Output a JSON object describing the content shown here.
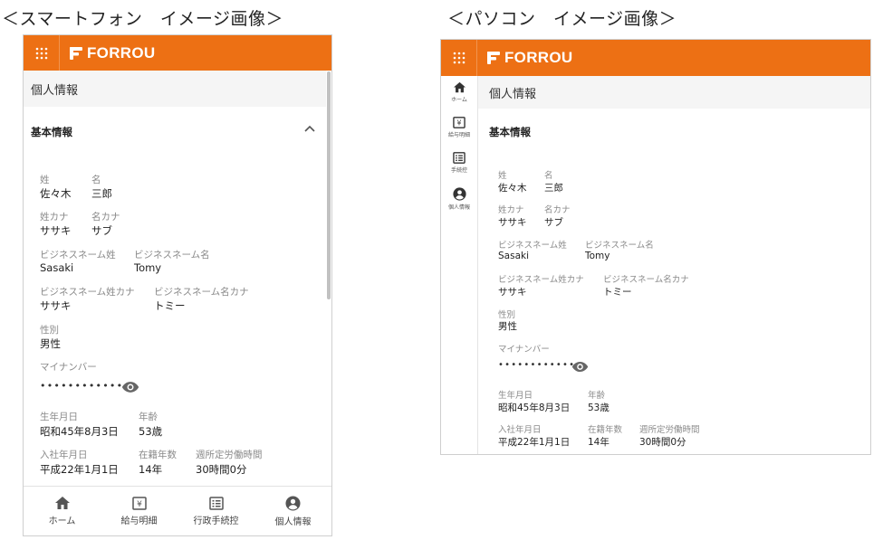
{
  "captions": {
    "smartphone": "＜スマートフォン　イメージ画像＞",
    "pc": "＜パソコン　イメージ画像＞"
  },
  "app": {
    "logo_text": "FORROU",
    "accent_color": "#ed7014",
    "page_title": "個人情報",
    "section_title": "基本情報"
  },
  "icons": {
    "grid": "grid-icon",
    "chevron": "chevron-up-icon",
    "eye": "eye-icon",
    "home": "home-icon",
    "salary": "yen-slip-icon",
    "procedure": "form-icon",
    "profile": "account-circle-icon"
  },
  "fields": {
    "last_name": {
      "label": "姓",
      "value": "佐々木"
    },
    "first_name": {
      "label": "名",
      "value": "三郎"
    },
    "last_name_kana": {
      "label": "姓カナ",
      "value": "ササキ"
    },
    "first_name_kana": {
      "label": "名カナ",
      "value": "サブ"
    },
    "business_last": {
      "label": "ビジネスネーム姓",
      "value": "Sasaki"
    },
    "business_first": {
      "label": "ビジネスネーム名",
      "value": "Tomy"
    },
    "business_last_kana": {
      "label": "ビジネスネーム姓カナ",
      "value": "ササキ"
    },
    "business_first_kana": {
      "label": "ビジネスネーム名カナ",
      "value": "トミー"
    },
    "gender": {
      "label": "性別",
      "value": "男性"
    },
    "my_number": {
      "label": "マイナンバー",
      "value": "••••••••••••"
    },
    "birthday": {
      "label": "生年月日",
      "value": "昭和45年8月3日"
    },
    "age": {
      "label": "年齢",
      "value": "53歳"
    },
    "join_date": {
      "label": "入社年月日",
      "value": "平成22年1月1日"
    },
    "tenure": {
      "label": "在籍年数",
      "value": "14年"
    },
    "weekly_hours": {
      "label": "週所定労働時間",
      "value": "30時間0分"
    }
  },
  "nav": {
    "smartphone": [
      "ホーム",
      "給与明細",
      "行政手続控",
      "個人情報"
    ],
    "pc": [
      "ホーム",
      "給与明細",
      "手続控",
      "個人情報"
    ]
  }
}
